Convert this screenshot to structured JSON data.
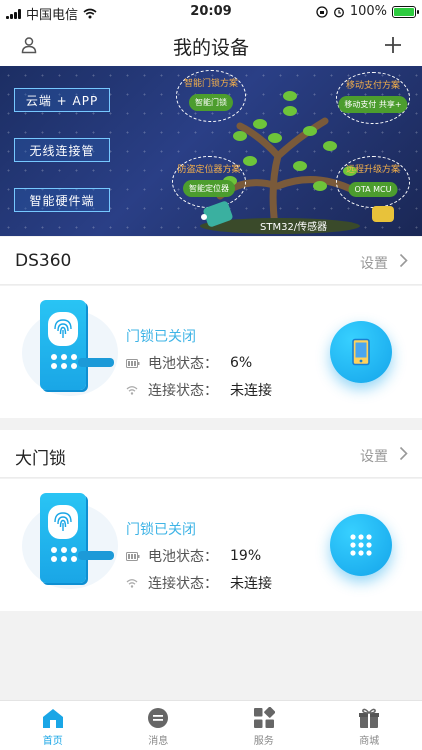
{
  "status_bar": {
    "carrier": "中国电信",
    "time": "20:09",
    "battery": "100%"
  },
  "header": {
    "title": "我的设备"
  },
  "banner": {
    "left_boxes": [
      "云端 + APP",
      "无线连接管",
      "智能硬件端"
    ],
    "bubbles": [
      {
        "title": "智能门锁方案",
        "tag": "智能门锁"
      },
      {
        "title": "移动支付方案",
        "tag": "移动支付 共享+"
      },
      {
        "title": "防盗定位器方案",
        "tag": "智能定位器"
      },
      {
        "title": "远程升级方案",
        "tag": "OTA MCU"
      }
    ],
    "footer_text": "STM32/传感器"
  },
  "devices": [
    {
      "name": "DS360",
      "settings_label": "设置",
      "lock_status": "门锁已关闭",
      "battery_label": "电池状态：",
      "battery_value": "6%",
      "conn_label": "连接状态：",
      "conn_value": "未连接",
      "action_icon": "phone-icon"
    },
    {
      "name": "大门锁",
      "settings_label": "设置",
      "lock_status": "门锁已关闭",
      "battery_label": "电池状态：",
      "battery_value": "19%",
      "conn_label": "连接状态：",
      "conn_value": "未连接",
      "action_icon": "keypad-icon"
    }
  ],
  "tabs": [
    {
      "label": "首页",
      "icon": "home-icon",
      "active": true
    },
    {
      "label": "消息",
      "icon": "message-icon",
      "active": false
    },
    {
      "label": "服务",
      "icon": "service-icon",
      "active": false
    },
    {
      "label": "商城",
      "icon": "gift-icon",
      "active": false
    }
  ],
  "colors": {
    "accent": "#1aa6e6",
    "status_text": "#3fb4e6"
  }
}
